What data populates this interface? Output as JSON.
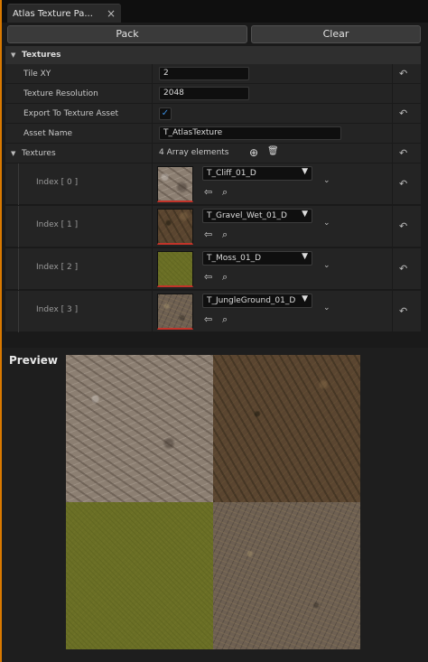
{
  "tab": {
    "title": "Atlas Texture Pa...",
    "close": "×"
  },
  "toolbar": {
    "pack_label": "Pack",
    "clear_label": "Clear"
  },
  "section": {
    "title": "Textures"
  },
  "properties": {
    "tile_xy": {
      "label": "Tile XY",
      "value": "2"
    },
    "texture_resolution": {
      "label": "Texture Resolution",
      "value": "2048"
    },
    "export_to_texture_asset": {
      "label": "Export To Texture Asset",
      "checked": true,
      "check_glyph": "✓"
    },
    "asset_name": {
      "label": "Asset Name",
      "value": "T_AtlasTexture"
    }
  },
  "textures_array": {
    "label": "Textures",
    "count_text": "4 Array elements",
    "elements": [
      {
        "index_label": "Index [ 0 ]",
        "asset": "T_Cliff_01_D",
        "texture": "cliff"
      },
      {
        "index_label": "Index [ 1 ]",
        "asset": "T_Gravel_Wet_01_D",
        "texture": "gravel"
      },
      {
        "index_label": "Index [ 2 ]",
        "asset": "T_Moss_01_D",
        "texture": "moss"
      },
      {
        "index_label": "Index [ 3 ]",
        "asset": "T_JungleGround_01_D",
        "texture": "jungle"
      }
    ]
  },
  "icons": {
    "reset": "↶",
    "add": "⊕",
    "delete": "🗑",
    "use_selected": "⇦",
    "browse": "⌕",
    "dropdown": "▼",
    "expand": "⌄",
    "caret": "▼"
  },
  "preview": {
    "title": "Preview"
  },
  "colors": {
    "accent": "#d97900",
    "checkbox": "#3a8bdc",
    "thumb_border": "#c2342a"
  }
}
